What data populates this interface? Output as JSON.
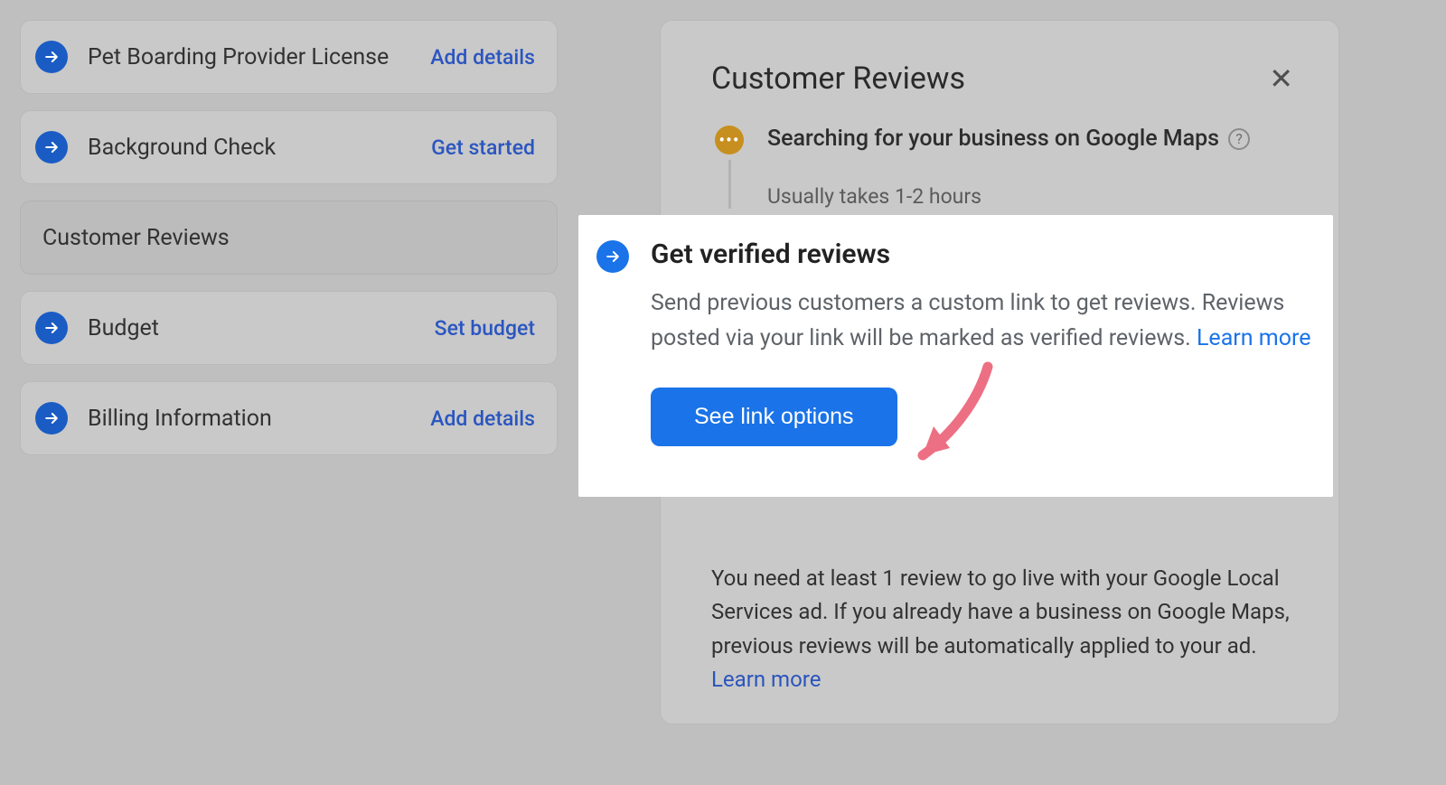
{
  "left_steps": [
    {
      "label": "Pet Boarding Provider License",
      "action": "Add details",
      "has_icon": true,
      "active": false
    },
    {
      "label": "Background Check",
      "action": "Get started",
      "has_icon": true,
      "active": false
    },
    {
      "label": "Customer Reviews",
      "action": "",
      "has_icon": false,
      "active": true
    },
    {
      "label": "Budget",
      "action": "Set budget",
      "has_icon": true,
      "active": false
    },
    {
      "label": "Billing Information",
      "action": "Add details",
      "has_icon": true,
      "active": false
    }
  ],
  "right_panel": {
    "title": "Customer Reviews",
    "search_step": {
      "title": "Searching for your business on Google Maps",
      "subtitle": "Usually takes 1-2 hours"
    },
    "bottom_note": {
      "text": "You need at least 1 review to go live with your Google Local Services ad. If you already have a business on Google Maps, previous reviews will be automatically applied to your ad. ",
      "learn_more": "Learn more"
    }
  },
  "highlight": {
    "title": "Get verified reviews",
    "description": "Send previous customers a custom link to get reviews. Reviews posted via your link will be marked as verified reviews. ",
    "learn_more": "Learn more",
    "button": "See link options"
  }
}
